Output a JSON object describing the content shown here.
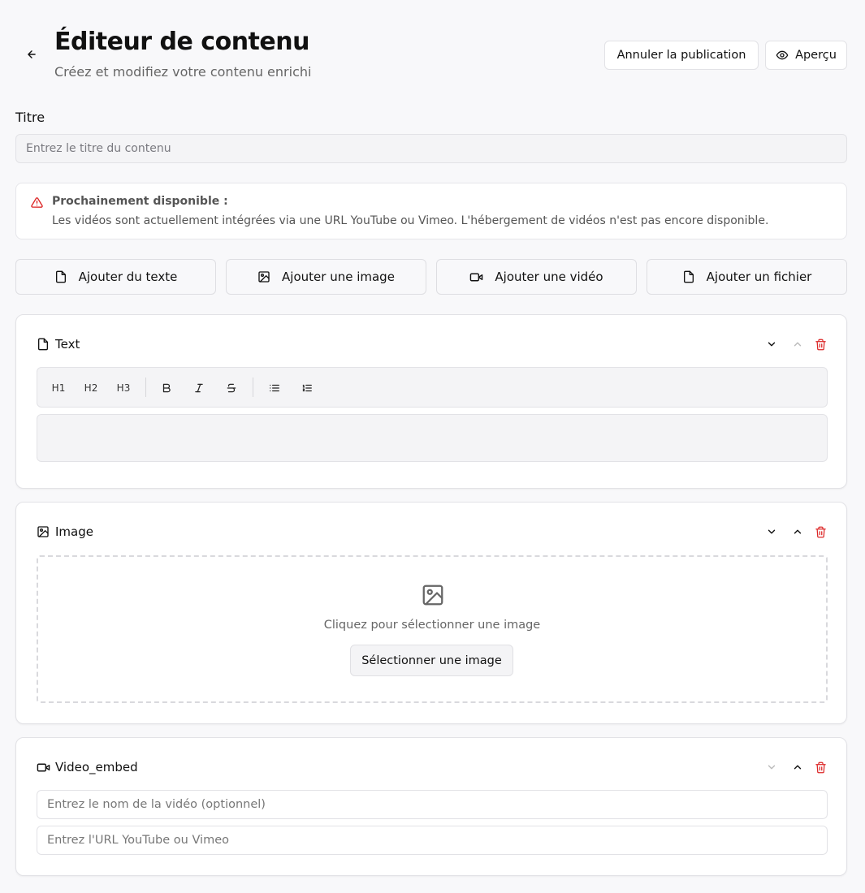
{
  "header": {
    "title": "Éditeur de contenu",
    "subtitle": "Créez et modifiez votre contenu enrichi",
    "unpublish_label": "Annuler la publication",
    "preview_label": "Aperçu"
  },
  "title_field": {
    "label": "Titre",
    "placeholder": "Entrez le titre du contenu",
    "value": ""
  },
  "alert": {
    "title": "Prochainement disponible :",
    "text": "Les vidéos sont actuellement intégrées via une URL YouTube ou Vimeo. L'hébergement de vidéos n'est pas encore disponible.",
    "color": "#dc2626"
  },
  "add_buttons": [
    {
      "label": "Ajouter du texte",
      "icon": "file-icon"
    },
    {
      "label": "Ajouter une image",
      "icon": "image-icon"
    },
    {
      "label": "Ajouter une vidéo",
      "icon": "video-icon"
    },
    {
      "label": "Ajouter un fichier",
      "icon": "file-icon"
    }
  ],
  "blocks": {
    "text": {
      "title": "Text",
      "toolbar": {
        "h1": "H1",
        "h2": "H2",
        "h3": "H3"
      }
    },
    "image": {
      "title": "Image",
      "dropzone_text": "Cliquez pour sélectionner une image",
      "select_label": "Sélectionner une image"
    },
    "video": {
      "title": "Video_embed",
      "name_placeholder": "Entrez le nom de la vidéo (optionnel)",
      "url_placeholder": "Entrez l'URL YouTube ou Vimeo"
    }
  },
  "colors": {
    "delete": "#dc2626",
    "background": "#f8f8fa"
  }
}
